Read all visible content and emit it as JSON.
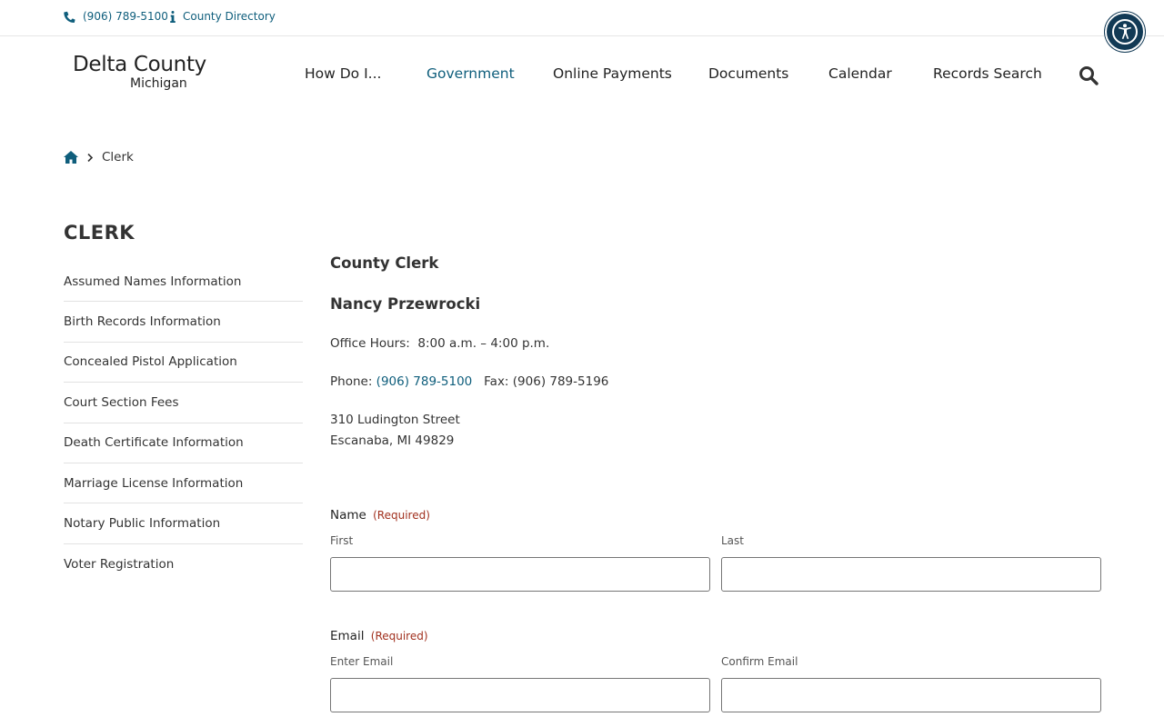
{
  "topbar": {
    "phone": "(906) 789-5100",
    "directory": "County Directory"
  },
  "logo": {
    "line1": "Delta County",
    "line2": "Michigan"
  },
  "nav": {
    "items": [
      "How Do I...",
      "Government",
      "Online Payments",
      "Documents",
      "Calendar",
      "Records Search"
    ],
    "active": "Government"
  },
  "breadcrumb": {
    "current": "Clerk"
  },
  "sidebar": {
    "title": "CLERK",
    "items": [
      "Assumed Names Information",
      "Birth Records Information",
      "Concealed Pistol Application",
      "Court Section Fees",
      "Death Certificate Information",
      "Marriage License Information",
      "Notary Public Information",
      "Voter Registration"
    ]
  },
  "content": {
    "title": "County Clerk",
    "name": "Nancy Przewrocki",
    "hours_label": "Office Hours:",
    "hours": "8:00 a.m. – 4:00 p.m.",
    "phone_label": "Phone:",
    "phone": "(906) 789-5100",
    "fax_label": "Fax:",
    "fax": "(906) 789-5196",
    "address1": "310 Ludington Street",
    "address2": "Escanaba, MI  49829"
  },
  "form": {
    "required_text": "(Required)",
    "name": {
      "label": "Name",
      "first": "First",
      "last": "Last"
    },
    "email": {
      "label": "Email",
      "enter": "Enter Email",
      "confirm": "Confirm Email"
    }
  },
  "colors": {
    "accent": "#0f5e7c",
    "required": "#a1301e",
    "a11y_button": "#123a55"
  }
}
